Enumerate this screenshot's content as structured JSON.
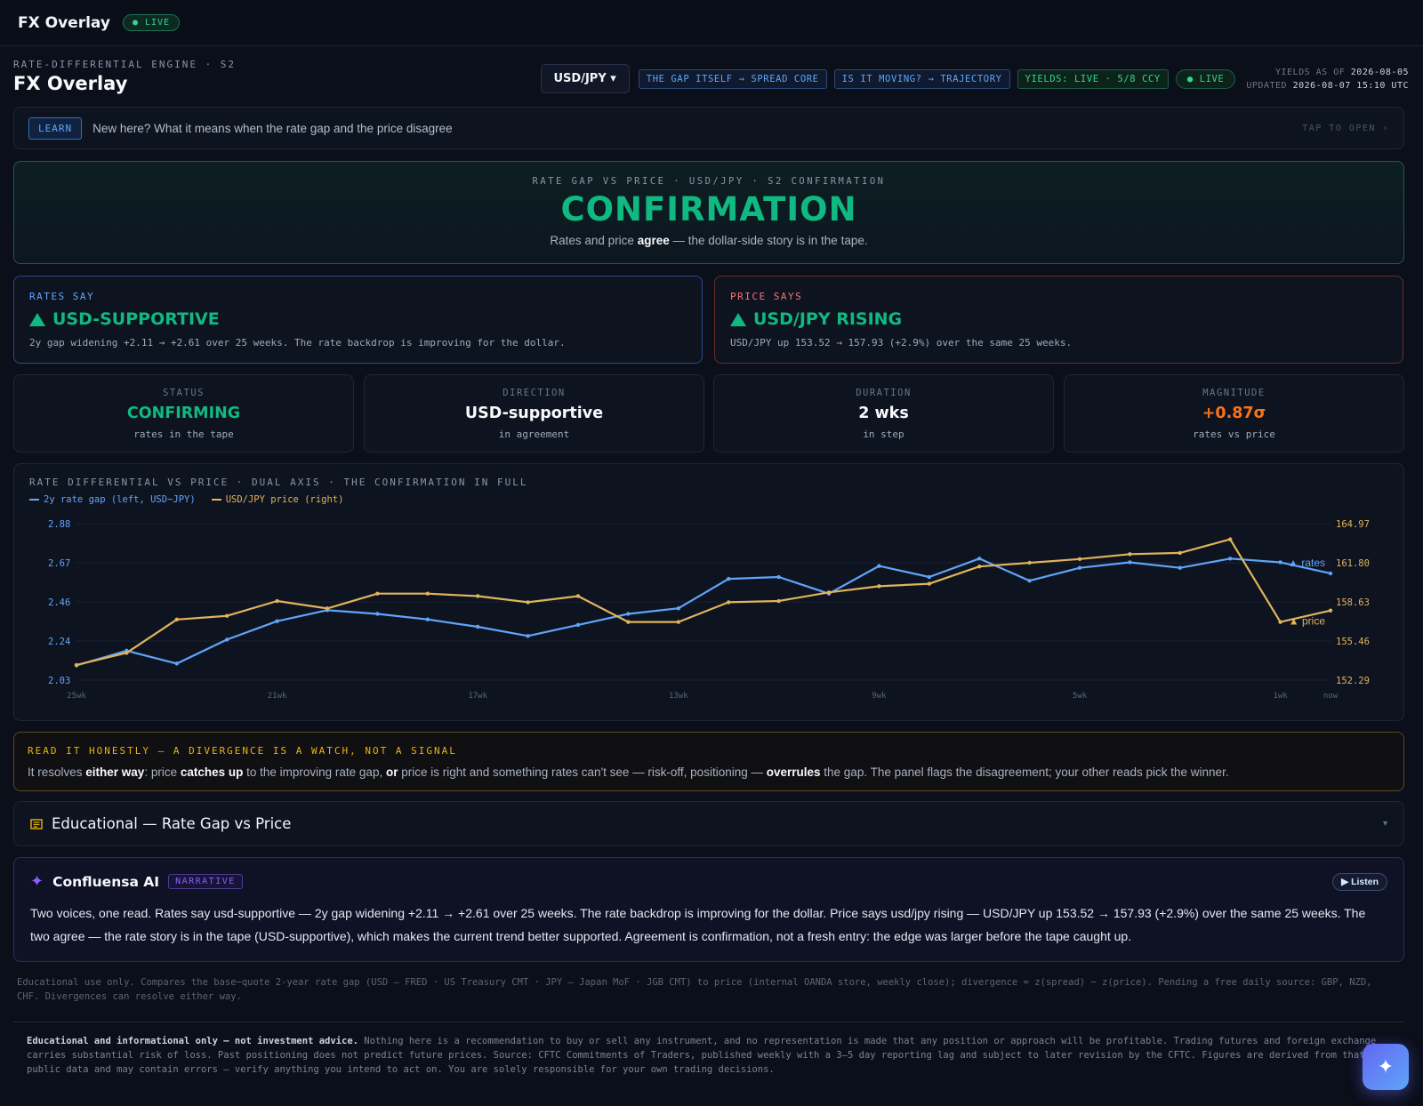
{
  "topbar": {
    "brand": "FX Overlay",
    "live": "● LIVE"
  },
  "header": {
    "eyebrow": "RATE-DIFFERENTIAL ENGINE · S2",
    "title": "FX Overlay",
    "pair": "USD/JPY ▾",
    "chips": [
      "THE GAP ITSELF → SPREAD CORE",
      "IS IT MOVING? → TRAJECTORY"
    ],
    "yields_chip": "YIELDS: LIVE · 5/8 CCY",
    "live_chip": "● LIVE",
    "yields_as_of_label": "YIELDS AS OF",
    "yields_as_of": "2026-08-05",
    "updated_label": "UPDATED",
    "updated": "2026-08-07 15:10 UTC"
  },
  "learn": {
    "button": "LEARN",
    "text": "New here? What it means when the rate gap and the price disagree",
    "tap": "TAP TO OPEN ›"
  },
  "hero": {
    "caption": "RATE GAP VS PRICE · USD/JPY · S2 CONFIRMATION",
    "verdict": "CONFIRMATION",
    "sub_a": "Rates and price ",
    "sub_b": "agree",
    "sub_c": " — the dollar-side story is in the tape."
  },
  "rates_say": {
    "label": "RATES SAY",
    "value": "USD-SUPPORTIVE",
    "desc": "2y gap widening +2.11 → +2.61 over 25 weeks. The rate backdrop is improving for the dollar."
  },
  "price_says": {
    "label": "PRICE SAYS",
    "value": "USD/JPY RISING",
    "desc": "USD/JPY up 153.52 → 157.93 (+2.9%) over the same 25 weeks."
  },
  "kpis": [
    {
      "k": "STATUS",
      "v": "CONFIRMING",
      "s": "rates in the tape",
      "color": "#10b981"
    },
    {
      "k": "DIRECTION",
      "v": "USD-supportive",
      "s": "in agreement",
      "color": "#f8fafc"
    },
    {
      "k": "DURATION",
      "v": "2 wks",
      "s": "in step",
      "color": "#f8fafc"
    },
    {
      "k": "MAGNITUDE",
      "v": "+0.87σ",
      "s": "rates vs price",
      "color": "#f97316"
    }
  ],
  "chart_data": {
    "type": "line",
    "title": "RATE DIFFERENTIAL VS PRICE · DUAL AXIS · THE CONFIRMATION IN FULL",
    "x": [
      "25wk",
      "24wk",
      "23wk",
      "22wk",
      "21wk",
      "20wk",
      "19wk",
      "18wk",
      "17wk",
      "16wk",
      "15wk",
      "14wk",
      "13wk",
      "12wk",
      "11wk",
      "10wk",
      "9wk",
      "8wk",
      "7wk",
      "6wk",
      "5wk",
      "4wk",
      "3wk",
      "2wk",
      "1wk",
      "now"
    ],
    "x_tick_labels": [
      "25wk",
      "21wk",
      "17wk",
      "13wk",
      "9wk",
      "5wk",
      "1wk",
      "now"
    ],
    "series": [
      {
        "name": "2y rate gap (left, USD−JPY)",
        "axis": "left",
        "color": "#60a5fa",
        "end_label": "▲ rates",
        "values": [
          2.11,
          2.19,
          2.12,
          2.25,
          2.35,
          2.41,
          2.39,
          2.36,
          2.32,
          2.27,
          2.33,
          2.39,
          2.42,
          2.58,
          2.59,
          2.5,
          2.65,
          2.59,
          2.69,
          2.57,
          2.64,
          2.67,
          2.64,
          2.69,
          2.67,
          2.61
        ]
      },
      {
        "name": "USD/JPY price (right)",
        "axis": "right",
        "color": "#e0b45a",
        "end_label": "▲ price",
        "values": [
          153.52,
          154.5,
          157.2,
          157.5,
          158.7,
          158.1,
          159.3,
          159.3,
          159.1,
          158.6,
          159.1,
          157.0,
          157.0,
          158.6,
          158.7,
          159.4,
          159.9,
          160.1,
          161.5,
          161.8,
          162.1,
          162.5,
          162.6,
          163.7,
          157.0,
          157.93
        ]
      }
    ],
    "y_left_ticks": [
      "2.88",
      "2.67",
      "2.46",
      "2.24",
      "2.03"
    ],
    "y_right_ticks": [
      "164.97",
      "161.80",
      "158.63",
      "155.46",
      "152.29"
    ],
    "ylim_left": [
      2.03,
      2.88
    ],
    "ylim_right": [
      152.29,
      164.97
    ],
    "grid": true,
    "legend": "top-left"
  },
  "honest": {
    "title": "READ IT HONESTLY — A DIVERGENCE IS A WATCH, NOT A SIGNAL",
    "t1": "It resolves ",
    "b1": "either way",
    "t2": ": price ",
    "b2": "catches up",
    "t3": " to the improving rate gap, ",
    "b3": "or",
    "t4": " price is right and something rates can't see — risk-off, positioning — ",
    "b4": "overrules",
    "t5": " the gap. The panel flags the disagreement; your other reads pick the winner."
  },
  "edu": {
    "title": "Educational — Rate Gap vs Price",
    "chev": "▾"
  },
  "ai": {
    "name": "Confluensa AI",
    "tag": "NARRATIVE",
    "listen": "▶ Listen",
    "body": "Two voices, one read. Rates say usd-supportive — 2y gap widening +2.11 → +2.61 over 25 weeks. The rate backdrop is improving for the dollar. Price says usd/jpy rising — USD/JPY up 153.52 → 157.93 (+2.9%) over the same 25 weeks. The two agree — the rate story is in the tape (USD-supportive), which makes the current trend better supported. Agreement is confirmation, not a fresh entry: the edge was larger before the tape caught up."
  },
  "foot1": "Educational use only. Compares the base−quote 2-year rate gap (USD — FRED · US Treasury CMT · JPY — Japan MoF · JGB CMT) to price (internal OANDA store, weekly close); divergence = z(spread) − z(price). Pending a free daily source: GBP, NZD, CHF. Divergences can resolve either way.",
  "foot2": {
    "bold": "Educational and informational only — not investment advice.",
    "text": " Nothing here is a recommendation to buy or sell any instrument, and no representation is made that any position or approach will be profitable. Trading futures and foreign exchange carries substantial risk of loss. Past positioning does not predict future prices. Source: CFTC Commitments of Traders, published weekly with a 3–5 day reporting lag and subject to later revision by the CFTC. Figures are derived from that public data and may contain errors — verify anything you intend to act on. You are solely responsible for your own trading decisions."
  },
  "fab": "✦"
}
